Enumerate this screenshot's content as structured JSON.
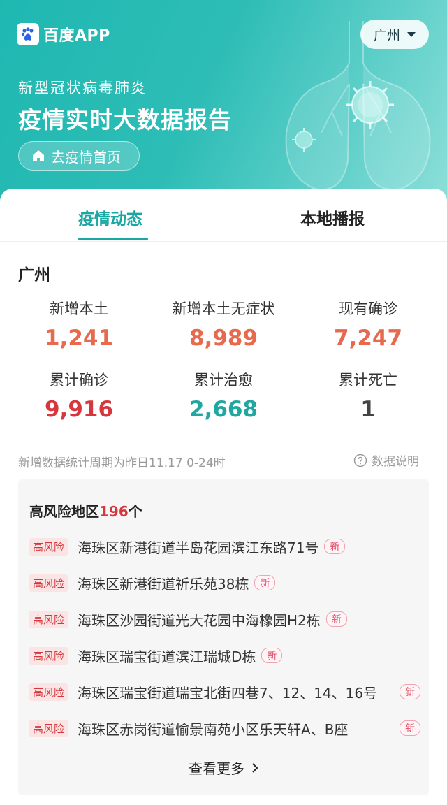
{
  "header": {
    "app_name": "百度APP",
    "city": "广州",
    "subtitle": "新型冠状病毒肺炎",
    "title": "疫情实时大数据报告",
    "home_button": "去疫情首页"
  },
  "tabs": [
    {
      "label": "疫情动态",
      "active": true
    },
    {
      "label": "本地播报",
      "active": false
    }
  ],
  "region": "广州",
  "stats": [
    {
      "label": "新增本土",
      "value": "1,241",
      "color": "#e86a4e"
    },
    {
      "label": "新增本土无症状",
      "value": "8,989",
      "color": "#e86a4e"
    },
    {
      "label": "现有确诊",
      "value": "7,247",
      "color": "#e86a4e"
    },
    {
      "label": "累计确诊",
      "value": "9,916",
      "color": "#d6363c"
    },
    {
      "label": "累计治愈",
      "value": "2,668",
      "color": "#21a7a2"
    },
    {
      "label": "累计死亡",
      "value": "1",
      "color": "#444444"
    }
  ],
  "note": "新增数据统计周期为昨日11.17 0-24时",
  "explain_label": "数据说明",
  "risk": {
    "title": "高风险地区",
    "count": "196",
    "unit": "个",
    "tag": "高风险",
    "new_tag": "新",
    "items": [
      "海珠区新港街道半岛花园滨江东路71号",
      "海珠区新港街道祈乐苑38栋",
      "海珠区沙园街道光大花园中海橡园H2栋",
      "海珠区瑞宝街道滨江瑞城D栋",
      "海珠区瑞宝街道瑞宝北街四巷7、12、14、16号",
      "海珠区赤岗街道愉景南苑小区乐天轩A、B座"
    ],
    "more_label": "查看更多"
  }
}
